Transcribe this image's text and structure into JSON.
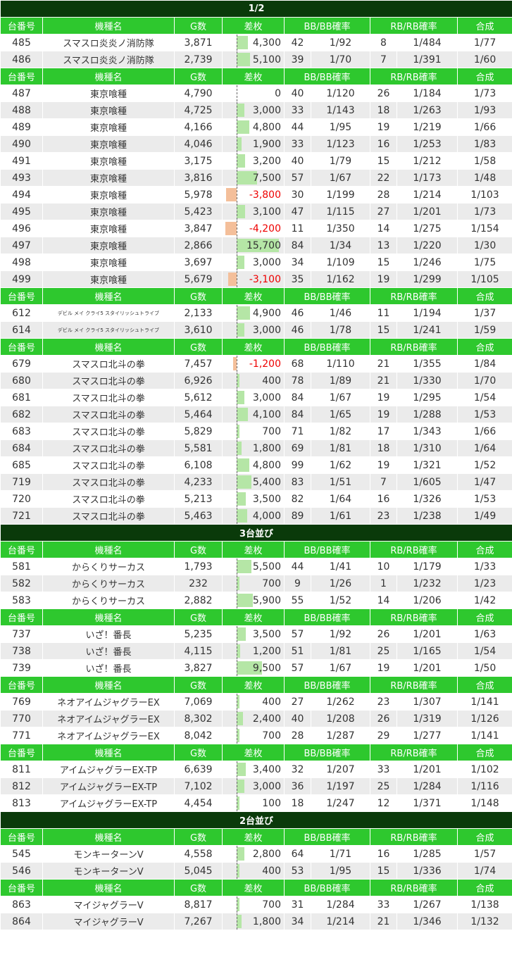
{
  "colors": {
    "section_bg": "#0a3a0a",
    "header_bg": "#2ec82e",
    "row_alt_bg": "#ebebeb",
    "positive_bar": "#b5e6a6",
    "negative_bar": "#f4bf9a",
    "negative_text": "#ee0000"
  },
  "headers": {
    "unit": "台番号",
    "machine": "機種名",
    "games": "G数",
    "diff": "差枚",
    "bb": "BB/BB確率",
    "rb": "RB/RB確率",
    "total": "合成"
  },
  "blocks": [
    {
      "type": "section",
      "title": "1/2"
    },
    {
      "type": "header"
    },
    {
      "type": "rows",
      "rows": [
        {
          "unit": "485",
          "machine": "スマスロ炎炎ノ消防隊",
          "games": "3,871",
          "diff": "4,300",
          "bb": "42",
          "bb_rate": "1/92",
          "rb": "8",
          "rb_rate": "1/484",
          "total": "1/77"
        },
        {
          "unit": "486",
          "machine": "スマスロ炎炎ノ消防隊",
          "games": "2,739",
          "diff": "5,100",
          "bb": "39",
          "bb_rate": "1/70",
          "rb": "7",
          "rb_rate": "1/391",
          "total": "1/60"
        }
      ]
    },
    {
      "type": "header"
    },
    {
      "type": "rows",
      "rows": [
        {
          "unit": "487",
          "machine": "東京喰種",
          "games": "4,790",
          "diff": "0",
          "bb": "40",
          "bb_rate": "1/120",
          "rb": "26",
          "rb_rate": "1/184",
          "total": "1/73"
        },
        {
          "unit": "488",
          "machine": "東京喰種",
          "games": "4,725",
          "diff": "3,000",
          "bb": "33",
          "bb_rate": "1/143",
          "rb": "18",
          "rb_rate": "1/263",
          "total": "1/93"
        },
        {
          "unit": "489",
          "machine": "東京喰種",
          "games": "4,166",
          "diff": "4,800",
          "bb": "44",
          "bb_rate": "1/95",
          "rb": "19",
          "rb_rate": "1/219",
          "total": "1/66"
        },
        {
          "unit": "490",
          "machine": "東京喰種",
          "games": "4,046",
          "diff": "1,900",
          "bb": "33",
          "bb_rate": "1/123",
          "rb": "16",
          "rb_rate": "1/253",
          "total": "1/83"
        },
        {
          "unit": "491",
          "machine": "東京喰種",
          "games": "3,175",
          "diff": "3,200",
          "bb": "40",
          "bb_rate": "1/79",
          "rb": "15",
          "rb_rate": "1/212",
          "total": "1/58"
        },
        {
          "unit": "493",
          "machine": "東京喰種",
          "games": "3,816",
          "diff": "7,500",
          "bb": "57",
          "bb_rate": "1/67",
          "rb": "22",
          "rb_rate": "1/173",
          "total": "1/48"
        },
        {
          "unit": "494",
          "machine": "東京喰種",
          "games": "5,978",
          "diff": "-3,800",
          "bb": "30",
          "bb_rate": "1/199",
          "rb": "28",
          "rb_rate": "1/214",
          "total": "1/103"
        },
        {
          "unit": "495",
          "machine": "東京喰種",
          "games": "5,423",
          "diff": "3,100",
          "bb": "47",
          "bb_rate": "1/115",
          "rb": "27",
          "rb_rate": "1/201",
          "total": "1/73"
        },
        {
          "unit": "496",
          "machine": "東京喰種",
          "games": "3,847",
          "diff": "-4,200",
          "bb": "11",
          "bb_rate": "1/350",
          "rb": "14",
          "rb_rate": "1/275",
          "total": "1/154"
        },
        {
          "unit": "497",
          "machine": "東京喰種",
          "games": "2,866",
          "diff": "15,700",
          "bb": "84",
          "bb_rate": "1/34",
          "rb": "13",
          "rb_rate": "1/220",
          "total": "1/30"
        },
        {
          "unit": "498",
          "machine": "東京喰種",
          "games": "3,697",
          "diff": "3,000",
          "bb": "34",
          "bb_rate": "1/109",
          "rb": "15",
          "rb_rate": "1/246",
          "total": "1/75"
        },
        {
          "unit": "499",
          "machine": "東京喰種",
          "games": "5,679",
          "diff": "-3,100",
          "bb": "35",
          "bb_rate": "1/162",
          "rb": "19",
          "rb_rate": "1/299",
          "total": "1/105"
        }
      ]
    },
    {
      "type": "header"
    },
    {
      "type": "rows",
      "rows": [
        {
          "unit": "612",
          "machine": "デビル メイ クライ5 スタイリッシュトライブ",
          "games": "2,133",
          "diff": "4,900",
          "bb": "46",
          "bb_rate": "1/46",
          "rb": "11",
          "rb_rate": "1/194",
          "total": "1/37"
        },
        {
          "unit": "614",
          "machine": "デビル メイ クライ5 スタイリッシュトライブ",
          "games": "3,610",
          "diff": "3,000",
          "bb": "46",
          "bb_rate": "1/78",
          "rb": "15",
          "rb_rate": "1/241",
          "total": "1/59"
        }
      ]
    },
    {
      "type": "header"
    },
    {
      "type": "rows",
      "rows": [
        {
          "unit": "679",
          "machine": "スマスロ北斗の拳",
          "games": "7,457",
          "diff": "-1,200",
          "bb": "68",
          "bb_rate": "1/110",
          "rb": "21",
          "rb_rate": "1/355",
          "total": "1/84"
        },
        {
          "unit": "680",
          "machine": "スマスロ北斗の拳",
          "games": "6,926",
          "diff": "400",
          "bb": "78",
          "bb_rate": "1/89",
          "rb": "21",
          "rb_rate": "1/330",
          "total": "1/70"
        },
        {
          "unit": "681",
          "machine": "スマスロ北斗の拳",
          "games": "5,612",
          "diff": "3,000",
          "bb": "84",
          "bb_rate": "1/67",
          "rb": "19",
          "rb_rate": "1/295",
          "total": "1/54"
        },
        {
          "unit": "682",
          "machine": "スマスロ北斗の拳",
          "games": "5,464",
          "diff": "4,100",
          "bb": "84",
          "bb_rate": "1/65",
          "rb": "19",
          "rb_rate": "1/288",
          "total": "1/53"
        },
        {
          "unit": "683",
          "machine": "スマスロ北斗の拳",
          "games": "5,829",
          "diff": "700",
          "bb": "71",
          "bb_rate": "1/82",
          "rb": "17",
          "rb_rate": "1/343",
          "total": "1/66"
        },
        {
          "unit": "684",
          "machine": "スマスロ北斗の拳",
          "games": "5,581",
          "diff": "1,800",
          "bb": "69",
          "bb_rate": "1/81",
          "rb": "18",
          "rb_rate": "1/310",
          "total": "1/64"
        },
        {
          "unit": "685",
          "machine": "スマスロ北斗の拳",
          "games": "6,108",
          "diff": "4,800",
          "bb": "99",
          "bb_rate": "1/62",
          "rb": "19",
          "rb_rate": "1/321",
          "total": "1/52"
        },
        {
          "unit": "719",
          "machine": "スマスロ北斗の拳",
          "games": "4,233",
          "diff": "5,400",
          "bb": "83",
          "bb_rate": "1/51",
          "rb": "7",
          "rb_rate": "1/605",
          "total": "1/47"
        },
        {
          "unit": "720",
          "machine": "スマスロ北斗の拳",
          "games": "5,213",
          "diff": "3,500",
          "bb": "82",
          "bb_rate": "1/64",
          "rb": "16",
          "rb_rate": "1/326",
          "total": "1/53"
        },
        {
          "unit": "721",
          "machine": "スマスロ北斗の拳",
          "games": "5,463",
          "diff": "4,000",
          "bb": "89",
          "bb_rate": "1/61",
          "rb": "23",
          "rb_rate": "1/238",
          "total": "1/49"
        }
      ]
    },
    {
      "type": "section",
      "title": "3台並び"
    },
    {
      "type": "header"
    },
    {
      "type": "rows",
      "rows": [
        {
          "unit": "581",
          "machine": "からくりサーカス",
          "games": "1,793",
          "diff": "5,500",
          "bb": "44",
          "bb_rate": "1/41",
          "rb": "10",
          "rb_rate": "1/179",
          "total": "1/33"
        },
        {
          "unit": "582",
          "machine": "からくりサーカス",
          "games": "232",
          "diff": "700",
          "bb": "9",
          "bb_rate": "1/26",
          "rb": "1",
          "rb_rate": "1/232",
          "total": "1/23"
        },
        {
          "unit": "583",
          "machine": "からくりサーカス",
          "games": "2,882",
          "diff": "5,900",
          "bb": "55",
          "bb_rate": "1/52",
          "rb": "14",
          "rb_rate": "1/206",
          "total": "1/42"
        }
      ]
    },
    {
      "type": "header"
    },
    {
      "type": "rows",
      "rows": [
        {
          "unit": "737",
          "machine": "いざ！番長",
          "games": "5,235",
          "diff": "3,500",
          "bb": "57",
          "bb_rate": "1/92",
          "rb": "26",
          "rb_rate": "1/201",
          "total": "1/63"
        },
        {
          "unit": "738",
          "machine": "いざ！番長",
          "games": "4,115",
          "diff": "1,200",
          "bb": "51",
          "bb_rate": "1/81",
          "rb": "25",
          "rb_rate": "1/165",
          "total": "1/54"
        },
        {
          "unit": "739",
          "machine": "いざ！番長",
          "games": "3,827",
          "diff": "9,500",
          "bb": "57",
          "bb_rate": "1/67",
          "rb": "19",
          "rb_rate": "1/201",
          "total": "1/50"
        }
      ]
    },
    {
      "type": "header"
    },
    {
      "type": "rows",
      "rows": [
        {
          "unit": "769",
          "machine": "ネオアイムジャグラーEX",
          "games": "7,069",
          "diff": "400",
          "bb": "27",
          "bb_rate": "1/262",
          "rb": "23",
          "rb_rate": "1/307",
          "total": "1/141"
        },
        {
          "unit": "770",
          "machine": "ネオアイムジャグラーEX",
          "games": "8,302",
          "diff": "2,400",
          "bb": "40",
          "bb_rate": "1/208",
          "rb": "26",
          "rb_rate": "1/319",
          "total": "1/126"
        },
        {
          "unit": "771",
          "machine": "ネオアイムジャグラーEX",
          "games": "8,042",
          "diff": "700",
          "bb": "28",
          "bb_rate": "1/287",
          "rb": "29",
          "rb_rate": "1/277",
          "total": "1/141"
        }
      ]
    },
    {
      "type": "header"
    },
    {
      "type": "rows",
      "rows": [
        {
          "unit": "811",
          "machine": "アイムジャグラーEX-TP",
          "games": "6,639",
          "diff": "3,400",
          "bb": "32",
          "bb_rate": "1/207",
          "rb": "33",
          "rb_rate": "1/201",
          "total": "1/102"
        },
        {
          "unit": "812",
          "machine": "アイムジャグラーEX-TP",
          "games": "7,102",
          "diff": "3,000",
          "bb": "36",
          "bb_rate": "1/197",
          "rb": "25",
          "rb_rate": "1/284",
          "total": "1/116"
        },
        {
          "unit": "813",
          "machine": "アイムジャグラーEX-TP",
          "games": "4,454",
          "diff": "100",
          "bb": "18",
          "bb_rate": "1/247",
          "rb": "12",
          "rb_rate": "1/371",
          "total": "1/148"
        }
      ]
    },
    {
      "type": "section",
      "title": "2台並び"
    },
    {
      "type": "header"
    },
    {
      "type": "rows",
      "rows": [
        {
          "unit": "545",
          "machine": "モンキーターンV",
          "games": "4,558",
          "diff": "2,800",
          "bb": "64",
          "bb_rate": "1/71",
          "rb": "16",
          "rb_rate": "1/285",
          "total": "1/57"
        },
        {
          "unit": "546",
          "machine": "モンキーターンV",
          "games": "5,045",
          "diff": "400",
          "bb": "53",
          "bb_rate": "1/95",
          "rb": "15",
          "rb_rate": "1/336",
          "total": "1/74"
        }
      ]
    },
    {
      "type": "header"
    },
    {
      "type": "rows",
      "rows": [
        {
          "unit": "863",
          "machine": "マイジャグラーV",
          "games": "8,817",
          "diff": "700",
          "bb": "31",
          "bb_rate": "1/284",
          "rb": "33",
          "rb_rate": "1/267",
          "total": "1/138"
        },
        {
          "unit": "864",
          "machine": "マイジャグラーV",
          "games": "7,267",
          "diff": "1,800",
          "bb": "34",
          "bb_rate": "1/214",
          "rb": "21",
          "rb_rate": "1/346",
          "total": "1/132"
        }
      ]
    }
  ]
}
